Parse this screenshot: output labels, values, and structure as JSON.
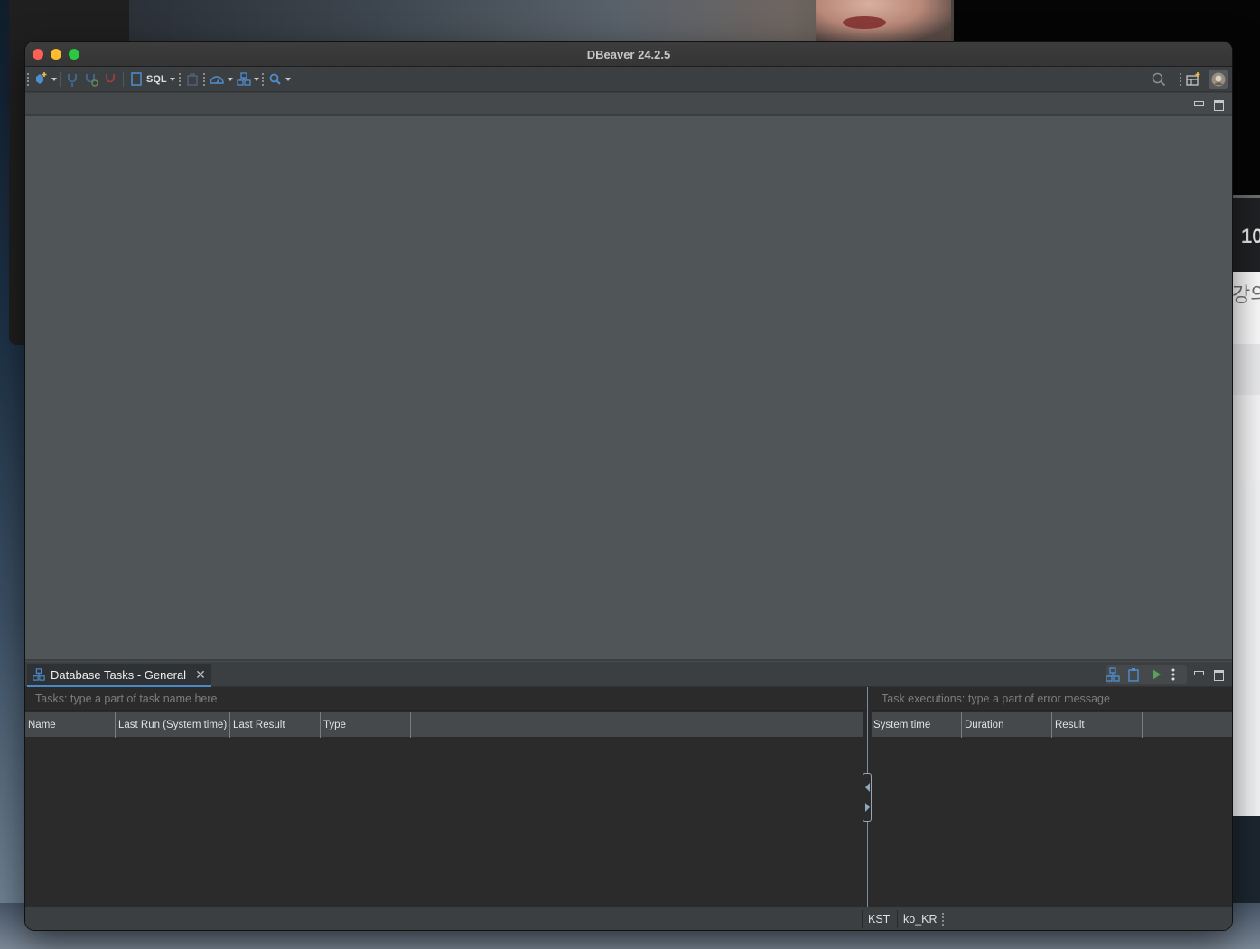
{
  "window": {
    "title": "DBeaver 24.2.5"
  },
  "toolbar": {
    "sql_label": "SQL",
    "icons": [
      "new-connection-icon",
      "connect-icon",
      "invalidate-reconnect-icon",
      "disconnect-icon",
      "sql-editor-icon",
      "transaction-mode-icon",
      "performance-dashboard-icon",
      "database-tasks-icon",
      "search-icon",
      "global-search-icon",
      "perspective-icon",
      "user-avatar-icon"
    ]
  },
  "panel": {
    "tab_label": "Database Tasks - General",
    "tasks_filter": {
      "placeholder": "Tasks: type a part of task name here",
      "value": ""
    },
    "executions_filter": {
      "placeholder": "Task executions: type a part of error message",
      "value": ""
    },
    "tasks_columns": [
      "Name",
      "Last Run (System time)",
      "Last Result",
      "Type"
    ],
    "tasks_rows": [],
    "executions_columns": [
      "System time",
      "Duration",
      "Result"
    ],
    "executions_rows": []
  },
  "statusbar": {
    "timezone": "KST",
    "locale": "ko_KR"
  },
  "background": {
    "number_fragment": "10",
    "korean_fragment": "강의"
  },
  "colors": {
    "accent": "#4a88c7",
    "run_green": "#5aa05a",
    "editor_bg": "#505558",
    "panel_bg": "#2b2b2b"
  }
}
